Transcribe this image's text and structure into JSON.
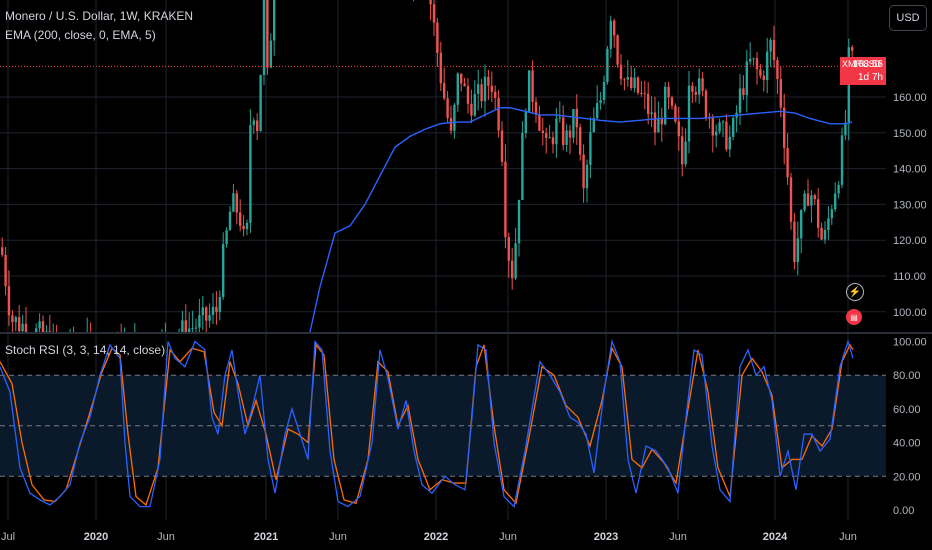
{
  "legend": {
    "symbol_line": "Monero / U.S. Dollar, 1W, KRAKEN",
    "ema_line": "EMA (200, close, 0, EMA, 5)",
    "stoch_line": "Stoch RSI (3, 3, 14, 14, close)"
  },
  "currency_button": "USD",
  "price_tag": {
    "symbol": "XMRUSD",
    "price": "168.56",
    "countdown": "1d 7h"
  },
  "colors": {
    "background": "#000000",
    "up": "#26a69a",
    "down": "#ef5350",
    "ema": "#2962ff",
    "stoch_k": "#2962ff",
    "stoch_d": "#ff6d00",
    "price_line": "#f23645",
    "grid": "#1e222d",
    "band_fill": "#0b1a2b"
  },
  "chart_data": [
    {
      "type": "candlestick",
      "title": "Monero / U.S. Dollar, 1W, KRAKEN",
      "ylim": [
        90,
        185
      ],
      "y_ticks": [
        "100.00",
        "110.00",
        "120.00",
        "130.00",
        "140.00",
        "150.00",
        "160.00"
      ],
      "x_ticks": [
        "Jul",
        "2020",
        "Jun",
        "2021",
        "Jun",
        "2022",
        "Jun",
        "2023",
        "Jun",
        "2024",
        "Jun"
      ],
      "current_price": 168.56,
      "series": [
        {
          "name": "EMA (200, close, 0, EMA, 5)",
          "points": [
            [
              310,
              88
            ],
            [
              320,
              107
            ],
            [
              335,
              122
            ],
            [
              350,
              124
            ],
            [
              365,
              130
            ],
            [
              380,
              138
            ],
            [
              395,
              146
            ],
            [
              410,
              149
            ],
            [
              425,
              151
            ],
            [
              440,
              152.5
            ],
            [
              455,
              153
            ],
            [
              470,
              153
            ],
            [
              485,
              155
            ],
            [
              500,
              157
            ],
            [
              510,
              157
            ],
            [
              525,
              156
            ],
            [
              540,
              155
            ],
            [
              555,
              155
            ],
            [
              570,
              154.5
            ],
            [
              585,
              154
            ],
            [
              600,
              153.5
            ],
            [
              620,
              153
            ],
            [
              640,
              153.5
            ],
            [
              660,
              154
            ],
            [
              680,
              154
            ],
            [
              700,
              154
            ],
            [
              720,
              154.5
            ],
            [
              740,
              155
            ],
            [
              760,
              155.5
            ],
            [
              780,
              156
            ],
            [
              795,
              155.5
            ],
            [
              810,
              154
            ],
            [
              830,
              152.5
            ],
            [
              845,
              152.5
            ],
            [
              852,
              153
            ]
          ]
        }
      ]
    },
    {
      "type": "line",
      "title": "Stoch RSI (3, 3, 14, 14, close)",
      "ylim": [
        0,
        100
      ],
      "y_ticks": [
        "0.00",
        "20.00",
        "40.00",
        "60.00",
        "80.00",
        "100.00"
      ],
      "bands": [
        20,
        50,
        80
      ],
      "series": [
        {
          "name": "K",
          "points": [
            [
              0,
              85
            ],
            [
              10,
              70
            ],
            [
              20,
              25
            ],
            [
              30,
              10
            ],
            [
              40,
              6
            ],
            [
              50,
              3
            ],
            [
              60,
              8
            ],
            [
              70,
              15
            ],
            [
              80,
              40
            ],
            [
              90,
              55
            ],
            [
              100,
              80
            ],
            [
              110,
              98
            ],
            [
              120,
              90
            ],
            [
              125,
              40
            ],
            [
              130,
              8
            ],
            [
              140,
              2
            ],
            [
              150,
              2
            ],
            [
              160,
              30
            ],
            [
              168,
              100
            ],
            [
              175,
              90
            ],
            [
              185,
              85
            ],
            [
              195,
              100
            ],
            [
              205,
              95
            ],
            [
              212,
              55
            ],
            [
              218,
              45
            ],
            [
              225,
              80
            ],
            [
              232,
              95
            ],
            [
              238,
              70
            ],
            [
              245,
              45
            ],
            [
              252,
              60
            ],
            [
              260,
              80
            ],
            [
              268,
              30
            ],
            [
              275,
              10
            ],
            [
              285,
              45
            ],
            [
              292,
              60
            ],
            [
              300,
              45
            ],
            [
              308,
              30
            ],
            [
              315,
              100
            ],
            [
              322,
              95
            ],
            [
              330,
              35
            ],
            [
              338,
              5
            ],
            [
              348,
              2
            ],
            [
              360,
              8
            ],
            [
              372,
              40
            ],
            [
              380,
              95
            ],
            [
              388,
              78
            ],
            [
              398,
              48
            ],
            [
              406,
              65
            ],
            [
              414,
              35
            ],
            [
              422,
              15
            ],
            [
              432,
              10
            ],
            [
              445,
              20
            ],
            [
              455,
              15
            ],
            [
              465,
              12
            ],
            [
              472,
              55
            ],
            [
              478,
              98
            ],
            [
              486,
              95
            ],
            [
              494,
              40
            ],
            [
              504,
              8
            ],
            [
              514,
              2
            ],
            [
              525,
              35
            ],
            [
              540,
              88
            ],
            [
              550,
              80
            ],
            [
              560,
              70
            ],
            [
              570,
              55
            ],
            [
              578,
              52
            ],
            [
              586,
              45
            ],
            [
              594,
              22
            ],
            [
              604,
              70
            ],
            [
              612,
              100
            ],
            [
              620,
              88
            ],
            [
              628,
              30
            ],
            [
              636,
              10
            ],
            [
              646,
              38
            ],
            [
              656,
              35
            ],
            [
              668,
              25
            ],
            [
              678,
              10
            ],
            [
              686,
              55
            ],
            [
              694,
              95
            ],
            [
              702,
              92
            ],
            [
              712,
              38
            ],
            [
              720,
              12
            ],
            [
              730,
              5
            ],
            [
              740,
              85
            ],
            [
              748,
              95
            ],
            [
              756,
              80
            ],
            [
              764,
              85
            ],
            [
              772,
              65
            ],
            [
              780,
              20
            ],
            [
              788,
              35
            ],
            [
              796,
              12
            ],
            [
              804,
              45
            ],
            [
              812,
              45
            ],
            [
              820,
              35
            ],
            [
              830,
              42
            ],
            [
              840,
              85
            ],
            [
              848,
              100
            ],
            [
              853,
              90
            ]
          ]
        },
        {
          "name": "D",
          "points": [
            [
              0,
              88
            ],
            [
              12,
              75
            ],
            [
              22,
              40
            ],
            [
              32,
              15
            ],
            [
              44,
              6
            ],
            [
              55,
              5
            ],
            [
              66,
              12
            ],
            [
              78,
              35
            ],
            [
              90,
              58
            ],
            [
              102,
              82
            ],
            [
              112,
              96
            ],
            [
              120,
              92
            ],
            [
              128,
              45
            ],
            [
              136,
              8
            ],
            [
              146,
              3
            ],
            [
              158,
              25
            ],
            [
              170,
              95
            ],
            [
              180,
              88
            ],
            [
              192,
              96
            ],
            [
              204,
              94
            ],
            [
              214,
              58
            ],
            [
              222,
              50
            ],
            [
              230,
              88
            ],
            [
              238,
              75
            ],
            [
              248,
              50
            ],
            [
              256,
              65
            ],
            [
              266,
              45
            ],
            [
              276,
              18
            ],
            [
              288,
              48
            ],
            [
              298,
              45
            ],
            [
              308,
              40
            ],
            [
              316,
              98
            ],
            [
              324,
              92
            ],
            [
              334,
              30
            ],
            [
              344,
              6
            ],
            [
              356,
              4
            ],
            [
              368,
              30
            ],
            [
              378,
              88
            ],
            [
              388,
              82
            ],
            [
              398,
              50
            ],
            [
              408,
              62
            ],
            [
              418,
              30
            ],
            [
              430,
              12
            ],
            [
              442,
              18
            ],
            [
              454,
              16
            ],
            [
              466,
              16
            ],
            [
              476,
              85
            ],
            [
              484,
              98
            ],
            [
              494,
              50
            ],
            [
              504,
              12
            ],
            [
              516,
              4
            ],
            [
              528,
              40
            ],
            [
              542,
              85
            ],
            [
              554,
              80
            ],
            [
              566,
              62
            ],
            [
              578,
              55
            ],
            [
              590,
              38
            ],
            [
              602,
              65
            ],
            [
              612,
              96
            ],
            [
              622,
              85
            ],
            [
              632,
              30
            ],
            [
              642,
              25
            ],
            [
              652,
              36
            ],
            [
              664,
              28
            ],
            [
              676,
              16
            ],
            [
              688,
              60
            ],
            [
              698,
              95
            ],
            [
              708,
              70
            ],
            [
              718,
              25
            ],
            [
              730,
              8
            ],
            [
              742,
              80
            ],
            [
              752,
              90
            ],
            [
              762,
              82
            ],
            [
              772,
              68
            ],
            [
              782,
              25
            ],
            [
              792,
              30
            ],
            [
              802,
              30
            ],
            [
              812,
              44
            ],
            [
              822,
              38
            ],
            [
              832,
              48
            ],
            [
              842,
              88
            ],
            [
              850,
              98
            ],
            [
              853,
              95
            ]
          ]
        }
      ]
    }
  ]
}
